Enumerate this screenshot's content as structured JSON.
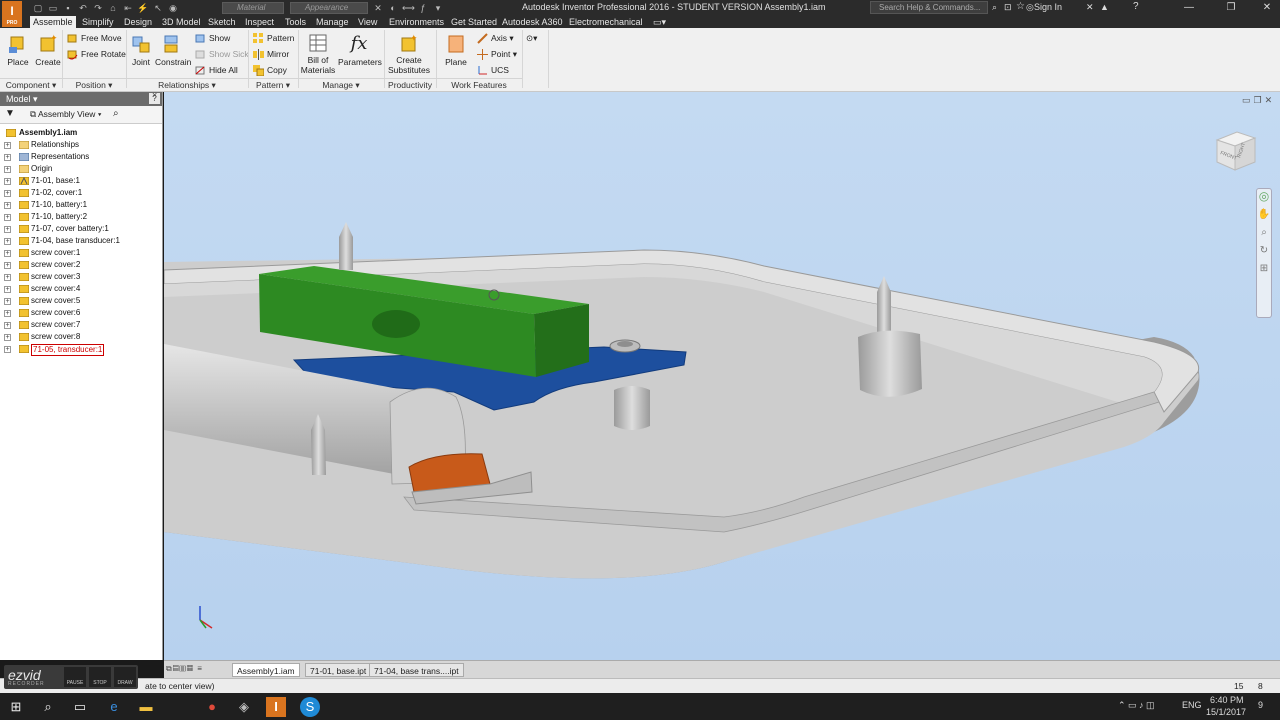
{
  "titlebar": {
    "app_logo": "I",
    "app_logo_sub": "PRO",
    "material_placeholder": "Material",
    "appearance_placeholder": "Appearance",
    "title": "Autodesk Inventor Professional 2016 - STUDENT VERSION    Assembly1.iam",
    "help_search_placeholder": "Search Help & Commands...",
    "sign_in": "Sign In"
  },
  "ribbon_tabs": [
    "Assemble",
    "Simplify",
    "Design",
    "3D Model",
    "Sketch",
    "Inspect",
    "Tools",
    "Manage",
    "View",
    "Environments",
    "Get Started",
    "Autodesk A360",
    "Electromechanical"
  ],
  "ribbon": {
    "component": {
      "place": "Place",
      "create": "Create",
      "panel": "Component ▾"
    },
    "position": {
      "free_move": "Free Move",
      "free_rotate": "Free Rotate",
      "panel": "Position ▾"
    },
    "relationships": {
      "joint": "Joint",
      "constrain": "Constrain",
      "show": "Show",
      "show_sick": "Show Sick",
      "hide_all": "Hide All",
      "panel": "Relationships ▾"
    },
    "pattern": {
      "pattern": "Pattern",
      "mirror": "Mirror",
      "copy": "Copy",
      "panel": "Pattern ▾"
    },
    "manage": {
      "bom_line1": "Bill of",
      "bom_line2": "Materials",
      "parameters": "Parameters",
      "panel": "Manage ▾"
    },
    "productivity": {
      "create_sub_line1": "Create",
      "create_sub_line2": "Substitutes",
      "panel": "Productivity"
    },
    "work_features": {
      "plane": "Plane",
      "axis": "Axis ▾",
      "point": "Point ▾",
      "ucs": "UCS",
      "panel": "Work Features"
    }
  },
  "browser": {
    "header": "Model ▾",
    "view_mode": "Assembly View",
    "help": "?",
    "close": "×",
    "root": "Assembly1.iam",
    "items": [
      {
        "label": "Relationships",
        "icon": "folder"
      },
      {
        "label": "Representations",
        "icon": "representations"
      },
      {
        "label": "Origin",
        "icon": "folder"
      },
      {
        "label": "71-01, base:1",
        "icon": "part-grounded"
      },
      {
        "label": "71-02, cover:1",
        "icon": "part"
      },
      {
        "label": "71-10, battery:1",
        "icon": "part"
      },
      {
        "label": "71-10, battery:2",
        "icon": "part"
      },
      {
        "label": "71-07, cover battery:1",
        "icon": "part"
      },
      {
        "label": "71-04, base transducer:1",
        "icon": "part"
      },
      {
        "label": "screw cover:1",
        "icon": "part"
      },
      {
        "label": "screw cover:2",
        "icon": "part"
      },
      {
        "label": "screw cover:3",
        "icon": "part"
      },
      {
        "label": "screw cover:4",
        "icon": "part"
      },
      {
        "label": "screw cover:5",
        "icon": "part"
      },
      {
        "label": "screw cover:6",
        "icon": "part"
      },
      {
        "label": "screw cover:7",
        "icon": "part"
      },
      {
        "label": "screw cover:8",
        "icon": "part"
      },
      {
        "label": "71-05, transducer:1",
        "icon": "part",
        "selected": true
      }
    ]
  },
  "viewcube": {
    "left": "FRONT",
    "right": "RIGHT"
  },
  "doc_tabs": [
    "Assembly1.iam",
    "71-01, base.ipt",
    "71-04, base trans....ipt"
  ],
  "status": {
    "message": "ate to center view)",
    "num1": "15",
    "num2": "8"
  },
  "ezvid": {
    "logo": "ezvid",
    "sub": "RECORDER",
    "pause": "PAUSE",
    "stop": "STOP",
    "draw": "DRAW"
  },
  "taskbar": {
    "lang": "ENG",
    "time": "6:40 PM",
    "date": "15/1/2017",
    "notifications": "9"
  },
  "colors": {
    "viewport_bg": "#c1d8f1",
    "part_gray": "#cfcfcf",
    "transducer_green": "#2f8a23",
    "pcb_blue": "#1d4f9e",
    "battery_cover_orange": "#c85a1a",
    "app_orange": "#d9741f"
  }
}
